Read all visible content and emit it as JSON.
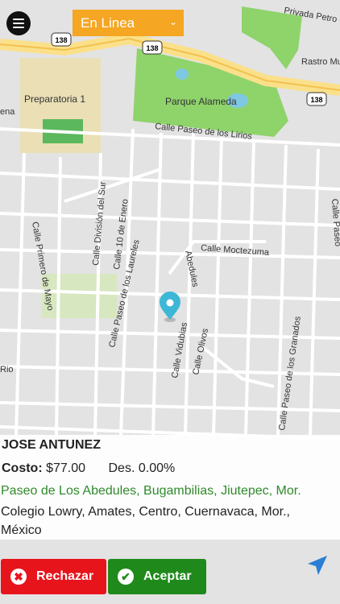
{
  "header": {
    "status_value": "En Linea"
  },
  "map": {
    "highway_number": "138",
    "labels": {
      "privada_petro": "Privada Petro",
      "rastro": "Rastro Mu",
      "preparatoria": "Preparatoria 1",
      "parque": "Parque Alameda",
      "lirios": "Calle Paseo de los Lirios",
      "ena": "ena",
      "division": "Calle División del Sur",
      "enero": "Calle 10 de Enero",
      "primero_mayo": "Calle Primero de Mayo",
      "laureles": "Calle Paseo de los Laureles",
      "abedules": "Abedules",
      "moctezuma": "Calle Moctezuma",
      "vidubias": "Calle Vidubias",
      "olivos": "Calle Olivos",
      "granados": "Calle Paseo de los Granados",
      "rio": "Rio",
      "paseo_right": "Calle Paseo"
    }
  },
  "trip": {
    "client_name": "JOSE ANTUNEZ",
    "cost_label": "Costo:",
    "cost_value": "$77.00",
    "discount": "Des. 0.00%",
    "origin": "Paseo de Los Abedules, Bugambilias, Jiutepec, Mor.",
    "destination": "Colegio Lowry, Amates, Centro, Cuernavaca, Mor., México"
  },
  "actions": {
    "reject_label": "Rechazar",
    "accept_label": "Aceptar"
  },
  "colors": {
    "status_bg": "#f5a623",
    "origin_text": "#2f8a2b",
    "reject_bg": "#e8141c",
    "accept_bg": "#1f8a1b",
    "nav_icon": "#2a7fd4"
  }
}
